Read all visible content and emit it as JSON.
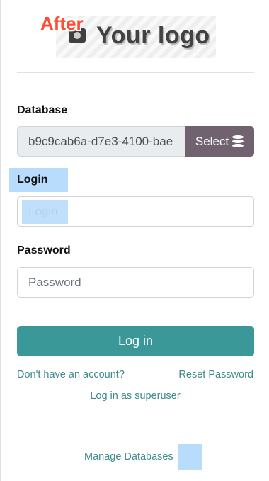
{
  "badge": "After",
  "logo": {
    "text": "Your logo",
    "icon": "camera-icon"
  },
  "database": {
    "label": "Database",
    "value": "b9c9cab6a-d7e3-4100-bae",
    "select_label": "Select",
    "select_icon": "database-icon"
  },
  "login": {
    "label": "Login",
    "placeholder": "Login"
  },
  "password": {
    "label": "Password",
    "placeholder": "Password"
  },
  "submit_label": "Log in",
  "links": {
    "signup": "Don't have an account?",
    "reset": "Reset Password",
    "superuser": "Log in as superuser",
    "manage": "Manage Databases"
  },
  "colors": {
    "primary": "#3a9998",
    "select_button": "#71626f",
    "link": "#3e8a8c",
    "badge": "#ff4b33",
    "highlight": "#b8dcfb"
  }
}
